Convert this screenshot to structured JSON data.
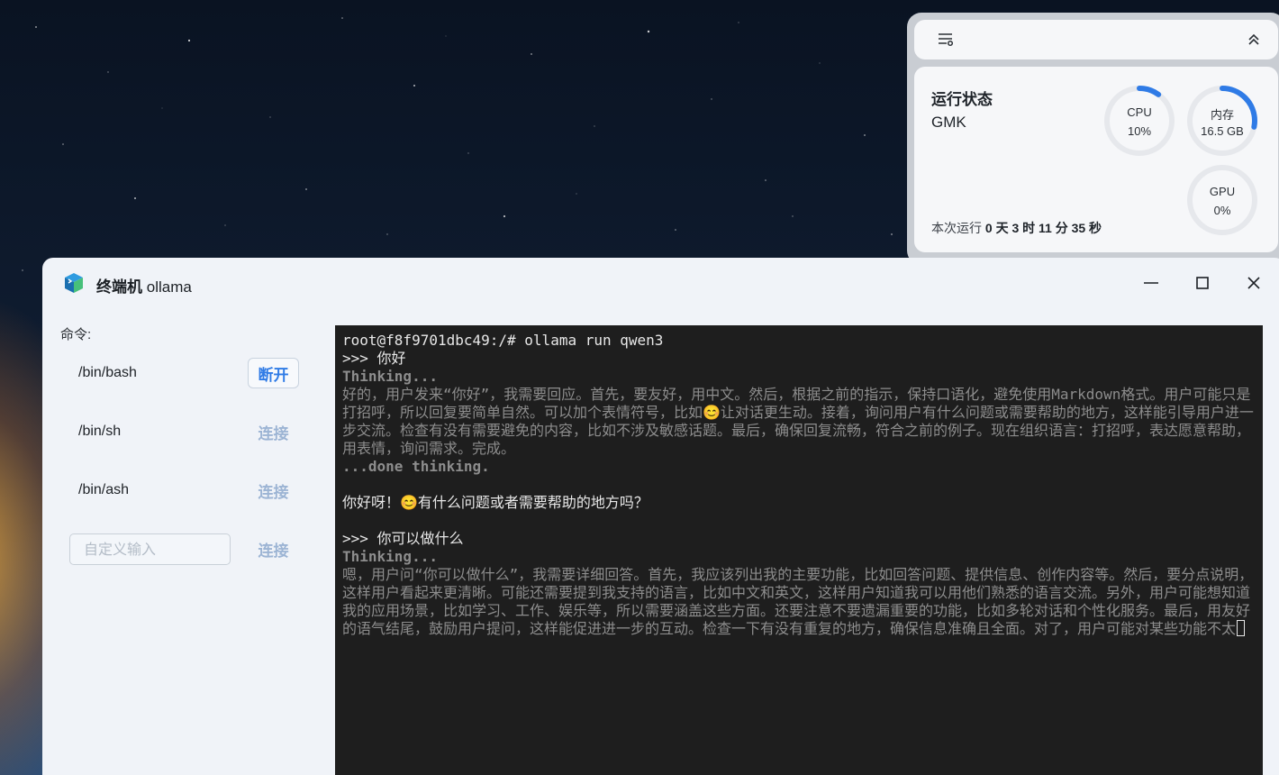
{
  "widget": {
    "title": "运行状态",
    "host": "GMK",
    "uptime_label": "本次运行",
    "uptime_value": "0 天 3 时 11 分 35 秒",
    "gauges": [
      {
        "name": "cpu",
        "label": "CPU",
        "value": "10%",
        "fraction": 0.1
      },
      {
        "name": "memory",
        "label": "内存",
        "value": "16.5 GB",
        "fraction": 0.28
      },
      {
        "name": "gpu",
        "label": "GPU",
        "value": "0%",
        "fraction": 0.0
      }
    ],
    "accent_color": "#2f7be6"
  },
  "window": {
    "title_prefix": "终端机",
    "title_app": "ollama",
    "controls": [
      "minimize-icon",
      "maximize-icon",
      "close-icon"
    ]
  },
  "sidebar": {
    "label": "命令:",
    "commands": [
      {
        "path": "/bin/bash",
        "action": "断开",
        "state": "connected"
      },
      {
        "path": "/bin/sh",
        "action": "连接",
        "state": "idle"
      },
      {
        "path": "/bin/ash",
        "action": "连接",
        "state": "idle"
      }
    ],
    "custom": {
      "placeholder": "自定义输入",
      "value": "",
      "action": "连接"
    }
  },
  "terminal": {
    "lines": [
      {
        "text": "root@f8f9701dbc49:/# ollama run qwen3",
        "style": "normal"
      },
      {
        "text": ">>> 你好",
        "style": "normal"
      },
      {
        "text": "Thinking...",
        "style": "dim-bold"
      },
      {
        "text": "好的，用户发来“你好”，我需要回应。首先，要友好，用中文。然后，根据之前的指示，保持口语化，避免使用Markdown格式。用户可能只是打招呼，所以回复要简单自然。可以加个表情符号，比如😊让对话更生动。接着，询问用户有什么问题或需要帮助的地方，这样能引导用户进一步交流。检查有没有需要避免的内容，比如不涉及敏感话题。最后，确保回复流畅，符合之前的例子。现在组织语言：打招呼，表达愿意帮助，用表情，询问需求。完成。",
        "style": "dim"
      },
      {
        "text": "...done thinking.",
        "style": "dim-bold"
      },
      {
        "text": "",
        "style": "normal"
      },
      {
        "text": "你好呀！😊有什么问题或者需要帮助的地方吗？",
        "style": "normal"
      },
      {
        "text": "",
        "style": "normal"
      },
      {
        "text": ">>> 你可以做什么",
        "style": "normal"
      },
      {
        "text": "Thinking...",
        "style": "dim-bold"
      },
      {
        "text": "嗯，用户问“你可以做什么”，我需要详细回答。首先，我应该列出我的主要功能，比如回答问题、提供信息、创作内容等。然后，要分点说明，这样用户看起来更清晰。可能还需要提到我支持的语言，比如中文和英文，这样用户知道我可以用他们熟悉的语言交流。另外，用户可能想知道我的应用场景，比如学习、工作、娱乐等，所以需要涵盖这些方面。还要注意不要遗漏重要的功能，比如多轮对话和个性化服务。最后，用友好的语气结尾，鼓励用户提问，这样能促进进一步的互动。检查一下有没有重复的地方，确保信息准确且全面。对了，用户可能对某些功能不太",
        "style": "dim",
        "cursor": true
      }
    ]
  }
}
